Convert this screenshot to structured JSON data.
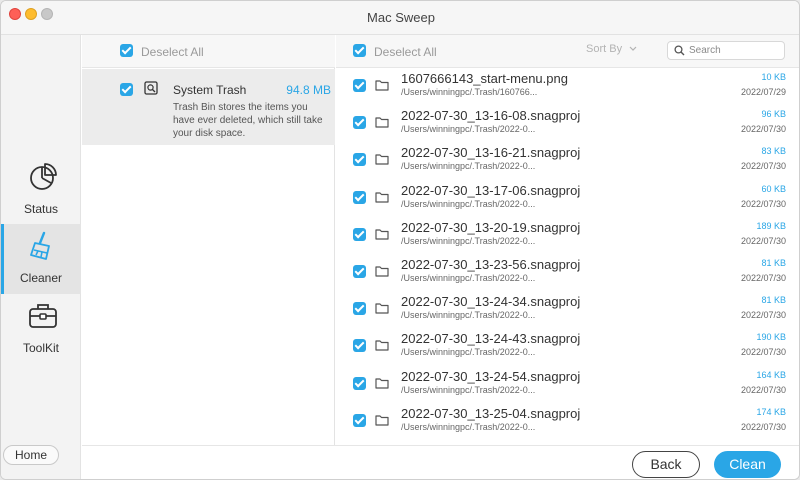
{
  "window": {
    "title": "Mac Sweep"
  },
  "sidebar": {
    "items": [
      {
        "label": "Status",
        "icon": "pie-chart-icon"
      },
      {
        "label": "Cleaner",
        "icon": "broom-icon"
      },
      {
        "label": "ToolKit",
        "icon": "toolbox-icon"
      }
    ],
    "home_label": "Home",
    "active": "Cleaner"
  },
  "middle": {
    "deselect_label": "Deselect All",
    "item": {
      "name": "System Trash",
      "size": "94.8 MB",
      "description": "Trash Bin stores the items you have ever deleted, which still take your disk space.",
      "icon": "trash-scan-icon"
    }
  },
  "right": {
    "deselect_label": "Deselect All",
    "sort_label": "Sort By",
    "search_placeholder": "Search",
    "files": [
      {
        "name": "1607666143_start-menu.png",
        "path": "/Users/winningpc/.Trash/160766...",
        "size": "10 KB",
        "date": "2022/07/29"
      },
      {
        "name": "2022-07-30_13-16-08.snagproj",
        "path": "/Users/winningpc/.Trash/2022-0...",
        "size": "96 KB",
        "date": "2022/07/30"
      },
      {
        "name": "2022-07-30_13-16-21.snagproj",
        "path": "/Users/winningpc/.Trash/2022-0...",
        "size": "83 KB",
        "date": "2022/07/30"
      },
      {
        "name": "2022-07-30_13-17-06.snagproj",
        "path": "/Users/winningpc/.Trash/2022-0...",
        "size": "60 KB",
        "date": "2022/07/30"
      },
      {
        "name": "2022-07-30_13-20-19.snagproj",
        "path": "/Users/winningpc/.Trash/2022-0...",
        "size": "189 KB",
        "date": "2022/07/30"
      },
      {
        "name": "2022-07-30_13-23-56.snagproj",
        "path": "/Users/winningpc/.Trash/2022-0...",
        "size": "81 KB",
        "date": "2022/07/30"
      },
      {
        "name": "2022-07-30_13-24-34.snagproj",
        "path": "/Users/winningpc/.Trash/2022-0...",
        "size": "81 KB",
        "date": "2022/07/30"
      },
      {
        "name": "2022-07-30_13-24-43.snagproj",
        "path": "/Users/winningpc/.Trash/2022-0...",
        "size": "190 KB",
        "date": "2022/07/30"
      },
      {
        "name": "2022-07-30_13-24-54.snagproj",
        "path": "/Users/winningpc/.Trash/2022-0...",
        "size": "164 KB",
        "date": "2022/07/30"
      },
      {
        "name": "2022-07-30_13-25-04.snagproj",
        "path": "/Users/winningpc/.Trash/2022-0...",
        "size": "174 KB",
        "date": "2022/07/30"
      }
    ]
  },
  "buttons": {
    "back": "Back",
    "clean": "Clean"
  },
  "colors": {
    "accent": "#2aa6e6",
    "traffic_close": "#fe5f57",
    "traffic_min": "#febc2e"
  }
}
